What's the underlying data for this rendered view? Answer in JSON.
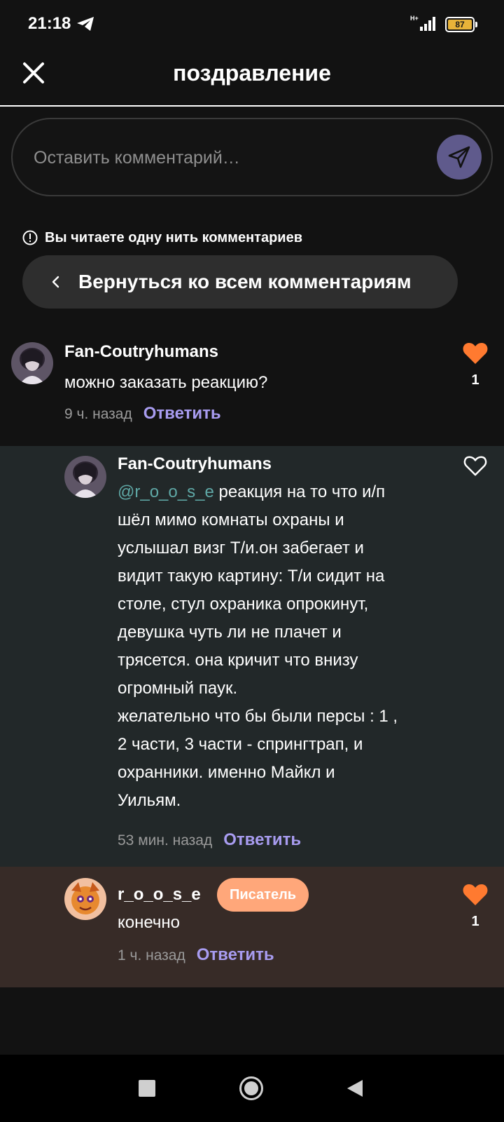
{
  "status_bar": {
    "time": "21:18",
    "network_label": "H+",
    "battery_level": "87",
    "icons": [
      "telegram-icon",
      "signal-icon",
      "battery-icon"
    ]
  },
  "header": {
    "title": "поздравление",
    "close_icon": "close-icon"
  },
  "comment_input": {
    "placeholder": "Оставить комментарий…",
    "send_icon": "send-icon"
  },
  "thread": {
    "notice": "Вы читаете одну нить комментариев",
    "notice_icon": "info-icon",
    "back_label": "Вернуться ко всем комментариям"
  },
  "comments": [
    {
      "author": "Fan-Coutryhumans",
      "text": "можно заказать реакцию?",
      "time": "9 ч. назад",
      "reply": "Ответить",
      "liked": true,
      "likes": "1"
    },
    {
      "author": "Fan-Coutryhumans",
      "mention": "@r_o_o_s_e",
      "text_lines": [
        " реакция на то что и/п",
        "шёл мимо комнаты охраны и",
        "услышал визг Т/и.он забегает и",
        "видит такую картину: Т/и сидит на",
        "столе, стул охраника опрокинут,",
        "девушка чуть ли не плачет и",
        "трясется. она кричит что внизу",
        "огромный паук.",
        "желательно что бы были персы : 1 ,",
        "2 части, 3 части - спрингтрап, и",
        "охранники. именно Майкл и",
        "Уильям."
      ],
      "time": "53 мин. назад",
      "reply": "Ответить",
      "liked": false
    },
    {
      "author": "r_o_o_s_e",
      "badge": "Писатель",
      "text": "конечно",
      "time": "1 ч. назад",
      "reply": "Ответить",
      "liked": true,
      "likes": "1"
    }
  ],
  "colors": {
    "background": "#121212",
    "reply_link": "#a89cf0",
    "like_active": "#ff7a30",
    "badge": "#ffa77a",
    "highlight_row": "#222829",
    "author_row": "#372b27",
    "mention": "#5fa8a6"
  },
  "nav_bar": {
    "icons": [
      "recent-apps-icon",
      "home-icon",
      "back-icon"
    ]
  }
}
